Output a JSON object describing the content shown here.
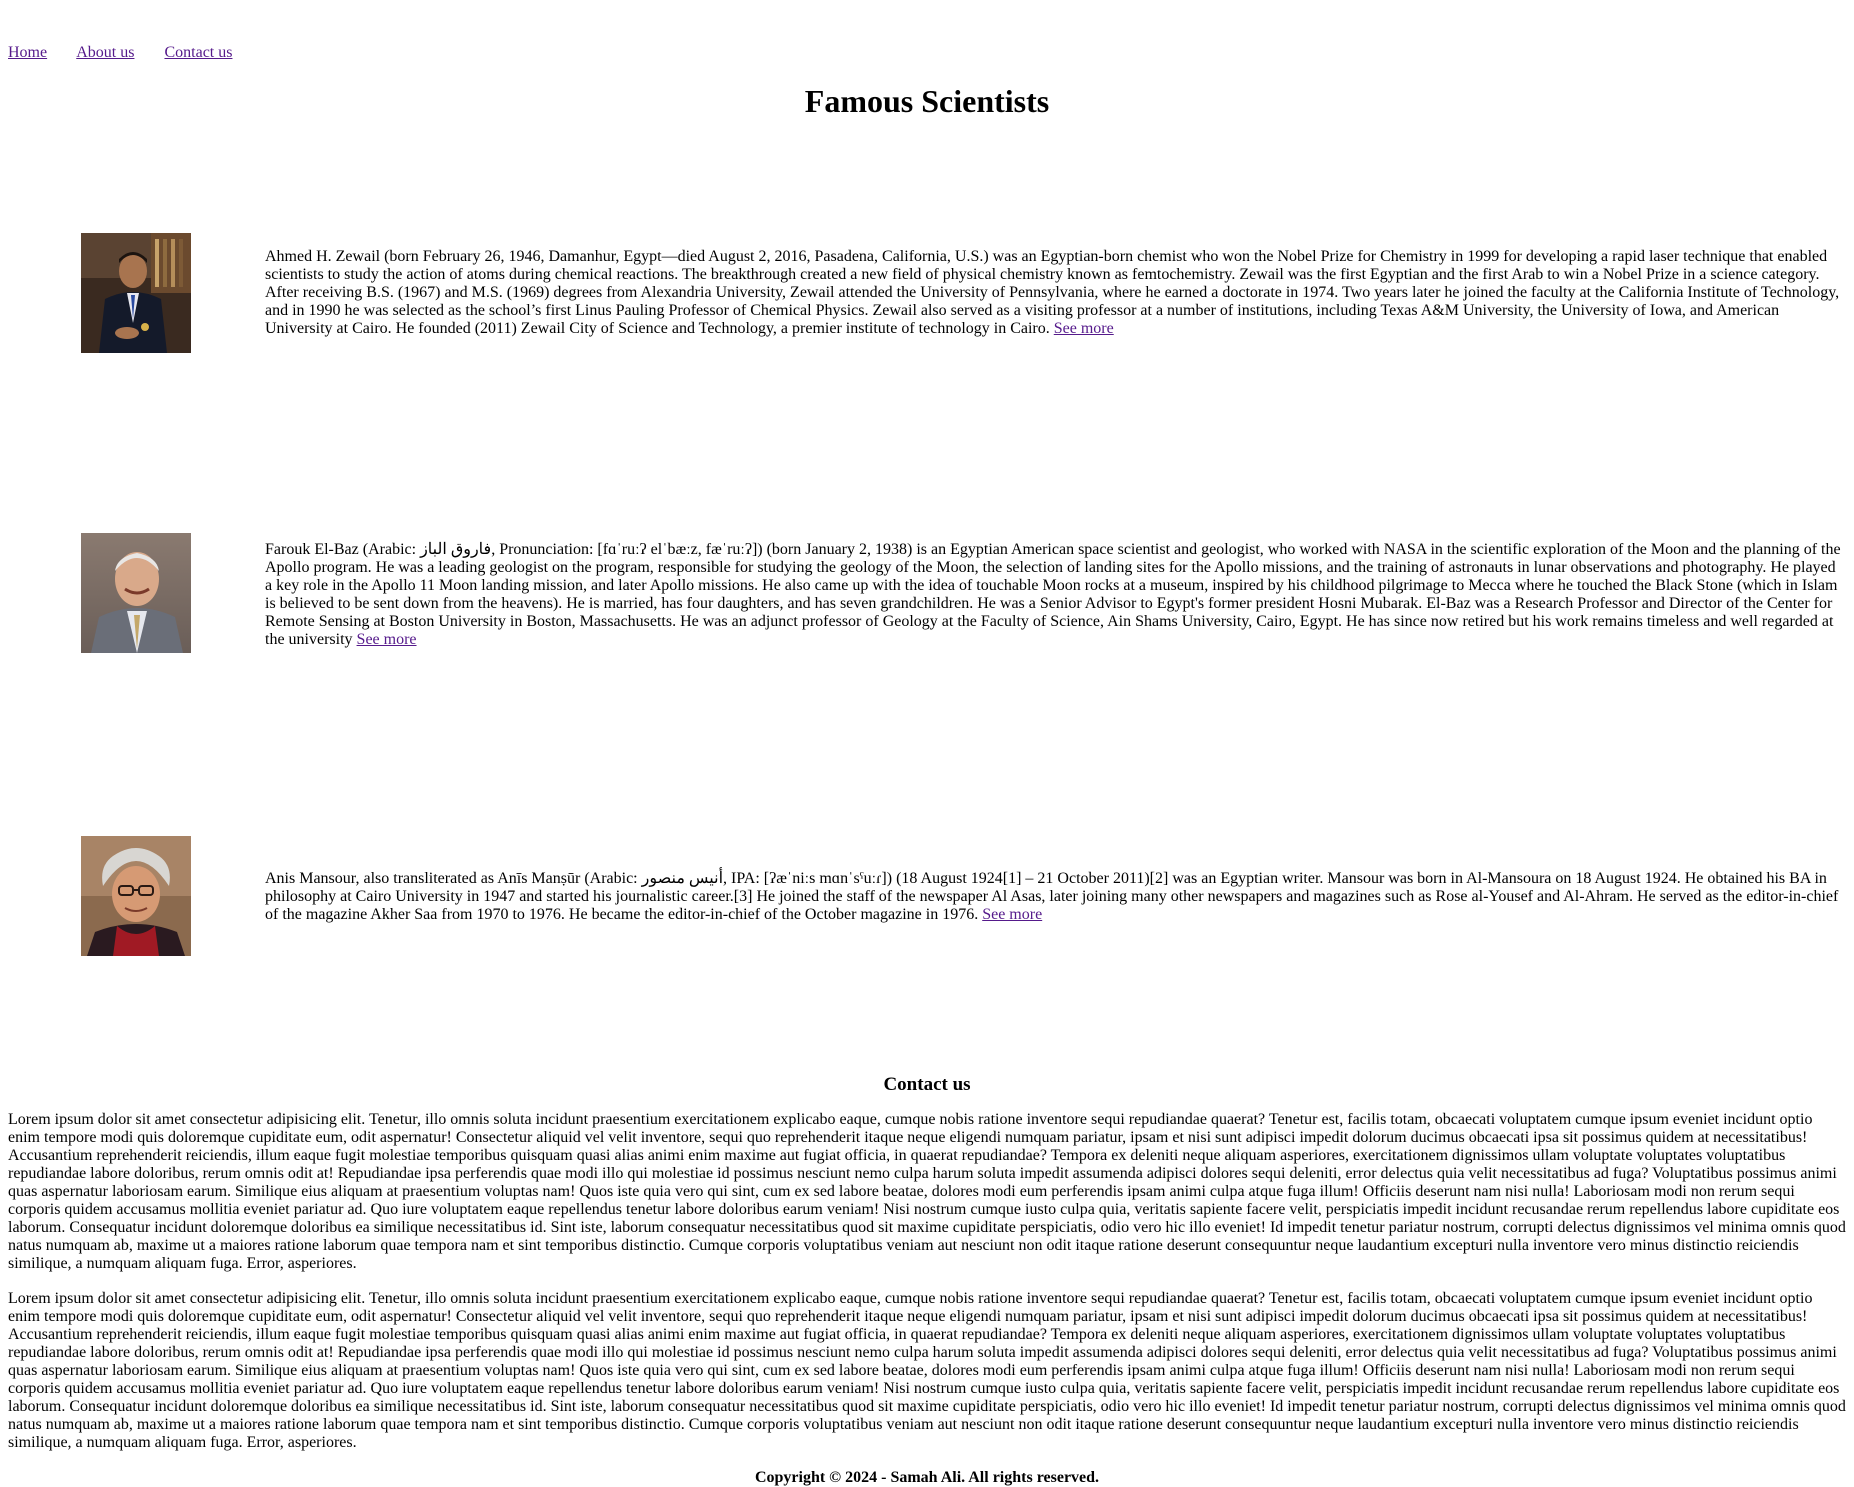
{
  "nav": {
    "home": "Home",
    "about": "About us",
    "contact": "Contact us"
  },
  "page_title": "Famous Scientists",
  "scientists": [
    {
      "photo_icon": "portrait-photo",
      "bio": "Ahmed H. Zewail (born February 26, 1946, Damanhur, Egypt—died August 2, 2016, Pasadena, California, U.S.) was an Egyptian-born chemist who won the Nobel Prize for Chemistry in 1999 for developing a rapid laser technique that enabled scientists to study the action of atoms during chemical reactions. The breakthrough created a new field of physical chemistry known as femtochemistry. Zewail was the first Egyptian and the first Arab to win a Nobel Prize in a science category. After receiving B.S. (1967) and M.S. (1969) degrees from Alexandria University, Zewail attended the University of Pennsylvania, where he earned a doctorate in 1974. Two years later he joined the faculty at the California Institute of Technology, and in 1990 he was selected as the school’s first Linus Pauling Professor of Chemical Physics. Zewail also served as a visiting professor at a number of institutions, including Texas A&M University, the University of Iowa, and American University at Cairo. He founded (2011) Zewail City of Science and Technology, a premier institute of technology in Cairo.",
      "see_more": "See more"
    },
    {
      "photo_icon": "portrait-photo",
      "bio": "Farouk El-Baz (Arabic: فاروق الباز, Pronunciation: [fɑˈruːʔ elˈbæːz, fæˈruːʔ]) (born January 2, 1938) is an Egyptian American space scientist and geologist, who worked with NASA in the scientific exploration of the Moon and the planning of the Apollo program. He was a leading geologist on the program, responsible for studying the geology of the Moon, the selection of landing sites for the Apollo missions, and the training of astronauts in lunar observations and photography. He played a key role in the Apollo 11 Moon landing mission, and later Apollo missions. He also came up with the idea of touchable Moon rocks at a museum, inspired by his childhood pilgrimage to Mecca where he touched the Black Stone (which in Islam is believed to be sent down from the heavens). He is married, has four daughters, and has seven grandchildren. He was a Senior Advisor to Egypt's former president Hosni Mubarak. El-Baz was a Research Professor and Director of the Center for Remote Sensing at Boston University in Boston, Massachusetts. He was an adjunct professor of Geology at the Faculty of Science, Ain Shams University, Cairo, Egypt. He has since now retired but his work remains timeless and well regarded at the university",
      "see_more": "See more"
    },
    {
      "photo_icon": "portrait-photo",
      "bio": "Anis Mansour, also transliterated as Anīs Manṣūr (Arabic: أنيس منصور, IPA: [ʔæˈniːs mɑnˈsˤuːɾ]) (18 August 1924[1] – 21 October 2011)[2] was an Egyptian writer. Mansour was born in Al-Mansoura on 18 August 1924. He obtained his BA in philosophy at Cairo University in 1947 and started his journalistic career.[3] He joined the staff of the newspaper Al Asas, later joining many other newspapers and magazines such as Rose al-Yousef and Al-Ahram. He served as the editor-in-chief of the magazine Akher Saa from 1970 to 1976. He became the editor-in-chief of the October magazine in 1976.",
      "see_more": "See more"
    }
  ],
  "contact": {
    "heading": "Contact us",
    "paragraphs": [
      "Lorem ipsum dolor sit amet consectetur adipisicing elit. Tenetur, illo omnis soluta incidunt praesentium exercitationem explicabo eaque, cumque nobis ratione inventore sequi repudiandae quaerat? Tenetur est, facilis totam, obcaecati voluptatem cumque ipsum eveniet incidunt optio enim tempore modi quis doloremque cupiditate eum, odit aspernatur! Consectetur aliquid vel velit inventore, sequi quo reprehenderit itaque neque eligendi numquam pariatur, ipsam et nisi sunt adipisci impedit dolorum ducimus obcaecati ipsa sit possimus quidem at necessitatibus! Accusantium reprehenderit reiciendis, illum eaque fugit molestiae temporibus quisquam quasi alias animi enim maxime aut fugiat officia, in quaerat repudiandae? Tempora ex deleniti neque aliquam asperiores, exercitationem dignissimos ullam voluptate voluptates voluptatibus repudiandae labore doloribus, rerum omnis odit at! Repudiandae ipsa perferendis quae modi illo qui molestiae id possimus nesciunt nemo culpa harum soluta impedit assumenda adipisci dolores sequi deleniti, error delectus quia velit necessitatibus ad fuga? Voluptatibus possimus animi quas aspernatur laboriosam earum. Similique eius aliquam at praesentium voluptas nam! Quos iste quia vero qui sint, cum ex sed labore beatae, dolores modi eum perferendis ipsam animi culpa atque fuga illum! Officiis deserunt nam nisi nulla! Laboriosam modi non rerum sequi corporis quidem accusamus mollitia eveniet pariatur ad. Quo iure voluptatem eaque repellendus tenetur labore doloribus earum veniam! Nisi nostrum cumque iusto culpa quia, veritatis sapiente facere velit, perspiciatis impedit incidunt recusandae rerum repellendus labore cupiditate eos laborum. Consequatur incidunt doloremque doloribus ea similique necessitatibus id. Sint iste, laborum consequatur necessitatibus quod sit maxime cupiditate perspiciatis, odio vero hic illo eveniet! Id impedit tenetur pariatur nostrum, corrupti delectus dignissimos vel minima omnis quod natus numquam ab, maxime ut a maiores ratione laborum quae tempora nam et sint temporibus distinctio. Cumque corporis voluptatibus veniam aut nesciunt non odit itaque ratione deserunt consequuntur neque laudantium excepturi nulla inventore vero minus distinctio reiciendis similique, a numquam aliquam fuga. Error, asperiores.",
      "Lorem ipsum dolor sit amet consectetur adipisicing elit. Tenetur, illo omnis soluta incidunt praesentium exercitationem explicabo eaque, cumque nobis ratione inventore sequi repudiandae quaerat? Tenetur est, facilis totam, obcaecati voluptatem cumque ipsum eveniet incidunt optio enim tempore modi quis doloremque cupiditate eum, odit aspernatur! Consectetur aliquid vel velit inventore, sequi quo reprehenderit itaque neque eligendi numquam pariatur, ipsam et nisi sunt adipisci impedit dolorum ducimus obcaecati ipsa sit possimus quidem at necessitatibus! Accusantium reprehenderit reiciendis, illum eaque fugit molestiae temporibus quisquam quasi alias animi enim maxime aut fugiat officia, in quaerat repudiandae? Tempora ex deleniti neque aliquam asperiores, exercitationem dignissimos ullam voluptate voluptates voluptatibus repudiandae labore doloribus, rerum omnis odit at! Repudiandae ipsa perferendis quae modi illo qui molestiae id possimus nesciunt nemo culpa harum soluta impedit assumenda adipisci dolores sequi deleniti, error delectus quia velit necessitatibus ad fuga? Voluptatibus possimus animi quas aspernatur laboriosam earum. Similique eius aliquam at praesentium voluptas nam! Quos iste quia vero qui sint, cum ex sed labore beatae, dolores modi eum perferendis ipsam animi culpa atque fuga illum! Officiis deserunt nam nisi nulla! Laboriosam modi non rerum sequi corporis quidem accusamus mollitia eveniet pariatur ad. Quo iure voluptatem eaque repellendus tenetur labore doloribus earum veniam! Nisi nostrum cumque iusto culpa quia, veritatis sapiente facere velit, perspiciatis impedit incidunt recusandae rerum repellendus labore cupiditate eos laborum. Consequatur incidunt doloremque doloribus ea similique necessitatibus id. Sint iste, laborum consequatur necessitatibus quod sit maxime cupiditate perspiciatis, odio vero hic illo eveniet! Id impedit tenetur pariatur nostrum, corrupti delectus dignissimos vel minima omnis quod natus numquam ab, maxime ut a maiores ratione laborum quae tempora nam et sint temporibus distinctio. Cumque corporis voluptatibus veniam aut nesciunt non odit itaque ratione deserunt consequuntur neque laudantium excepturi nulla inventore vero minus distinctio reiciendis similique, a numquam aliquam fuga. Error, asperiores."
    ]
  },
  "footer": {
    "copyright": "Copyright © 2024 - Samah Ali. All rights reserved."
  }
}
